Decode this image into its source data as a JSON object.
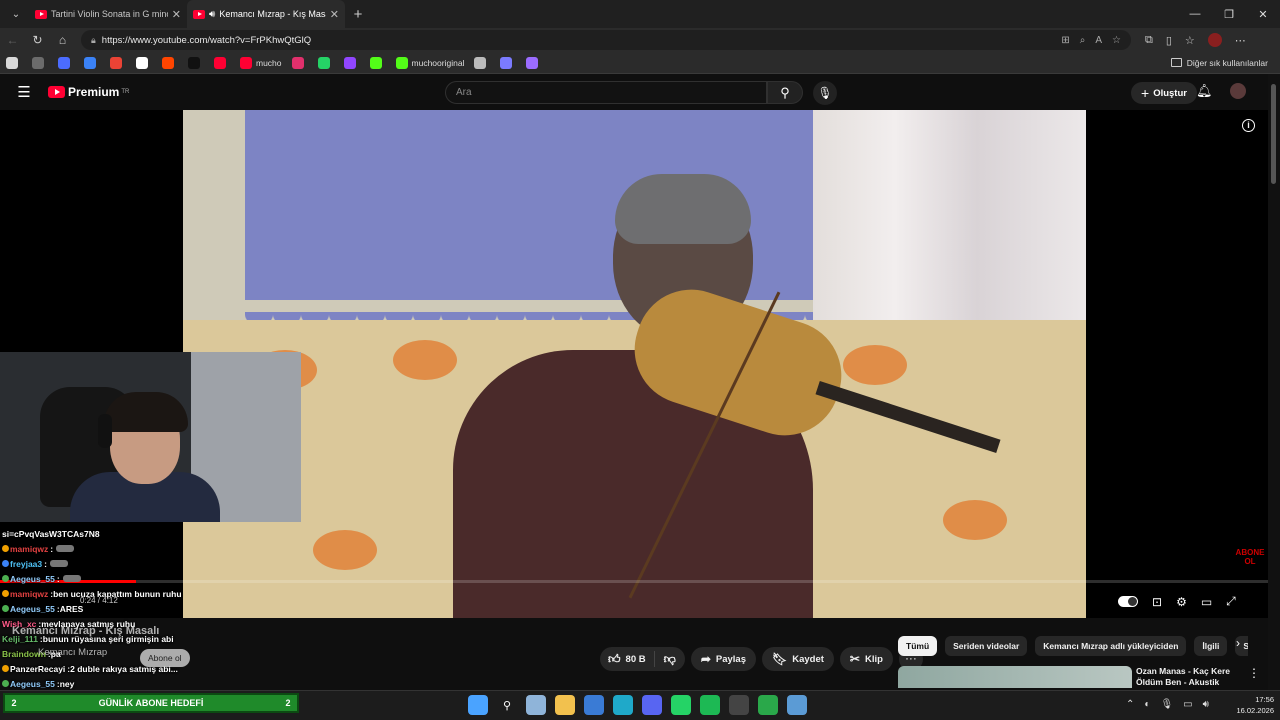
{
  "browser": {
    "tabs": [
      {
        "title": "Tartini Violin Sonata in G minor \"D",
        "active": false
      },
      {
        "title": "Kemancı Mızrap - Kış Masalı",
        "active": true
      }
    ],
    "new_tab": "+",
    "window_controls": [
      "—",
      "❐",
      "✕"
    ],
    "url": "https://www.youtube.com/watch?v=FrPKhwQtGlQ",
    "bookmarks": [
      {
        "label": "",
        "color": "#d9d9d9"
      },
      {
        "label": "",
        "color": "#6b6b6b"
      },
      {
        "label": "",
        "color": "#4b6cff"
      },
      {
        "label": "",
        "color": "#3b82f6"
      },
      {
        "label": "",
        "color": "#ea4335"
      },
      {
        "label": "",
        "color": "#ffffff"
      },
      {
        "label": "",
        "color": "#ff4500"
      },
      {
        "label": "",
        "color": "#111111"
      },
      {
        "label": "",
        "color": "#ff0033"
      },
      {
        "label": "mucho",
        "color": "#ff0033"
      },
      {
        "label": "",
        "color": "#e1306c"
      },
      {
        "label": "",
        "color": "#25d366"
      },
      {
        "label": "",
        "color": "#9146ff"
      },
      {
        "label": "",
        "color": "#53fc18"
      },
      {
        "label": "muchooriginal",
        "color": "#53fc18"
      },
      {
        "label": "",
        "color": "#bbbbbb"
      },
      {
        "label": "",
        "color": "#7b7bff"
      },
      {
        "label": "",
        "color": "#9b6cff"
      }
    ],
    "bookmarks_folder": "Diğer sık kullanılanlar"
  },
  "youtube": {
    "logo": "Premium",
    "region": "TR",
    "search_placeholder": "Ara",
    "create_label": "Oluştur",
    "player": {
      "time": "0:24 / 4:12",
      "progress": 0.107,
      "subscribe_badge": "ABONE OL"
    },
    "video_title": "Kemancı Mızrap - Kış Masalı",
    "channel": "Kemancı Mızrap",
    "subscribe_label": "Abone ol",
    "actions": {
      "likes": "80 B",
      "share": "Paylaş",
      "save": "Kaydet",
      "clip": "Klip",
      "more": "···"
    },
    "chips": [
      "Tümü",
      "Seriden videolar",
      "Kemancı Mızrap adlı yükleyiciden",
      "İlgili",
      "Size"
    ],
    "recommendation": {
      "title": "Ozan Manas - Kaç Kere Öldüm Ben - Akustik"
    }
  },
  "stream": {
    "chat": [
      {
        "user": "",
        "text": "si=cPvqVasW3TCAs7N8",
        "color": "#ffffff",
        "badge": ""
      },
      {
        "user": "mamiqwz",
        "text": "",
        "color": "#e04040",
        "badge": "b2",
        "emote": true
      },
      {
        "user": "freyjaa3",
        "text": "",
        "color": "#4fc3f7",
        "badge": "b3",
        "emote": true
      },
      {
        "user": "Aegeus_55",
        "text": "",
        "color": "#90caf9",
        "badge": "b",
        "emote": true
      },
      {
        "user": "mamiqwz",
        "text": "ben ucuza kapattım bunun ruhu",
        "color": "#e04040",
        "badge": "b2"
      },
      {
        "user": "Aegeus_55",
        "text": "ARES",
        "color": "#90caf9",
        "badge": "b"
      },
      {
        "user": "Wish_xc",
        "text": "mevlanaya satmış ruhu",
        "color": "#ff5b8a",
        "badge": ""
      },
      {
        "user": "Kelji_111",
        "text": "bunun rüyasına şeri girmişin abi",
        "color": "#66bb6a",
        "badge": ""
      },
      {
        "user": "Braindown",
        "text": "pa",
        "color": "#8bc34a",
        "badge": ""
      },
      {
        "user": "PanzerRecayi",
        "text": "2 duble rakıya satmış abi...",
        "color": "#ffffff",
        "badge": "b2"
      },
      {
        "user": "Aegeus_55",
        "text": "ney",
        "color": "#90caf9",
        "badge": "b"
      }
    ],
    "goal": {
      "left": "2",
      "label": "GÜNLİK ABONE HEDEFİ",
      "right": "2"
    }
  },
  "taskbar": {
    "apps": [
      {
        "name": "start",
        "color": "#4aa3ff"
      },
      {
        "name": "search",
        "color": "#ffffff"
      },
      {
        "name": "steam",
        "color": "#8fb4d9"
      },
      {
        "name": "explorer",
        "color": "#f2c14e"
      },
      {
        "name": "store",
        "color": "#3a7bd5"
      },
      {
        "name": "edge",
        "color": "#1fa9c9"
      },
      {
        "name": "discord",
        "color": "#5865f2"
      },
      {
        "name": "whatsapp",
        "color": "#25d366"
      },
      {
        "name": "spotify",
        "color": "#1db954"
      },
      {
        "name": "obs",
        "color": "#444444"
      },
      {
        "name": "app",
        "color": "#2aa84a"
      },
      {
        "name": "app2",
        "color": "#5b9bd5"
      }
    ],
    "time": "17:56",
    "date": "16.02.2026"
  }
}
